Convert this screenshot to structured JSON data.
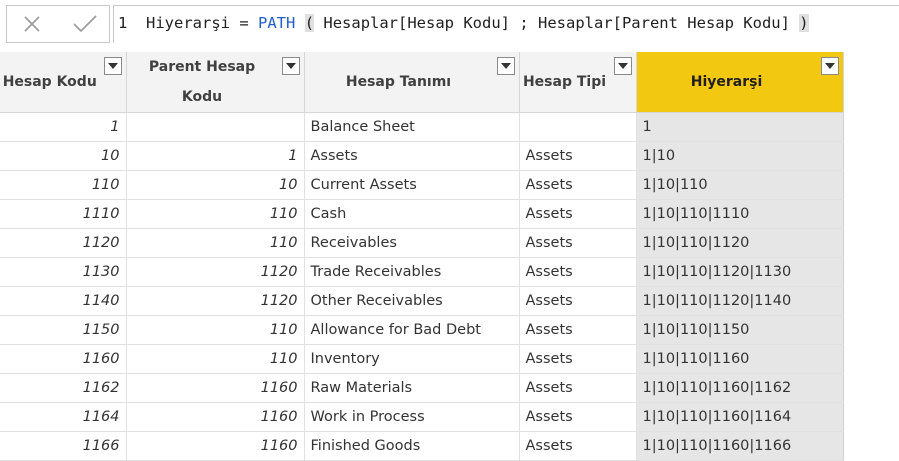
{
  "formula_bar": {
    "line_number": "1",
    "column_name": "Hiyerarşi",
    "operator": " = ",
    "function": "PATH",
    "open_paren": "(",
    "arg1": " Hesaplar[Hesap Kodu] ; Hesaplar[Parent Hesap Kodu] ",
    "close_paren": ")",
    "cancel_icon": "x-icon",
    "commit_icon": "checkmark-icon"
  },
  "table": {
    "columns": [
      "Hesap Kodu",
      "Parent Hesap Kodu",
      "Hesap Tanımı",
      "Hesap Tipi",
      "Hiyerarşi"
    ],
    "active_column_color": "#f2c811",
    "rows": [
      [
        "1",
        "",
        "Balance Sheet",
        "",
        "1"
      ],
      [
        "10",
        "1",
        "Assets",
        "Assets",
        "1|10"
      ],
      [
        "110",
        "10",
        "Current Assets",
        "Assets",
        "1|10|110"
      ],
      [
        "1110",
        "110",
        "Cash",
        "Assets",
        "1|10|110|1110"
      ],
      [
        "1120",
        "110",
        "Receivables",
        "Assets",
        "1|10|110|1120"
      ],
      [
        "1130",
        "1120",
        "Trade Receivables",
        "Assets",
        "1|10|110|1120|1130"
      ],
      [
        "1140",
        "1120",
        "Other Receivables",
        "Assets",
        "1|10|110|1120|1140"
      ],
      [
        "1150",
        "110",
        "Allowance for Bad Debt",
        "Assets",
        "1|10|110|1150"
      ],
      [
        "1160",
        "110",
        "Inventory",
        "Assets",
        "1|10|110|1160"
      ],
      [
        "1162",
        "1160",
        "Raw Materials",
        "Assets",
        "1|10|110|1160|1162"
      ],
      [
        "1164",
        "1160",
        "Work in Process",
        "Assets",
        "1|10|110|1160|1164"
      ],
      [
        "1166",
        "1160",
        "Finished Goods",
        "Assets",
        "1|10|110|1160|1166"
      ]
    ]
  }
}
